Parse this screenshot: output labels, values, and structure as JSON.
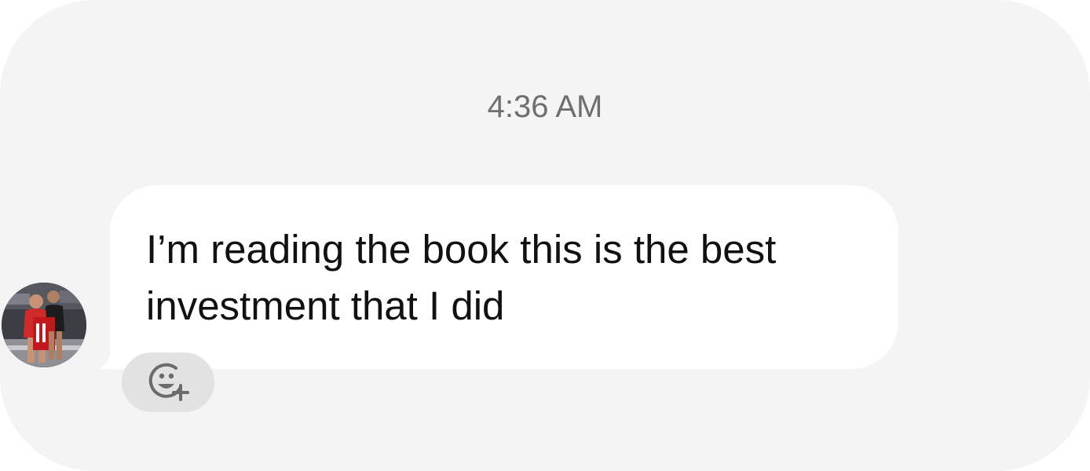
{
  "conversation": {
    "timestamp": "4:36 AM",
    "messages": [
      {
        "direction": "incoming",
        "text": "I’m reading the book this is the best investment that I did",
        "sender_avatar": "avatar-photo",
        "reaction_button_icon": "add-reaction-icon"
      }
    ]
  },
  "colors": {
    "background": "#f4f4f4",
    "bubble": "#ffffff",
    "timestamp_text": "#6f6f6f",
    "message_text": "#111111",
    "reaction_button": "#e2e2e2",
    "reaction_icon": "#6b6b6b"
  }
}
